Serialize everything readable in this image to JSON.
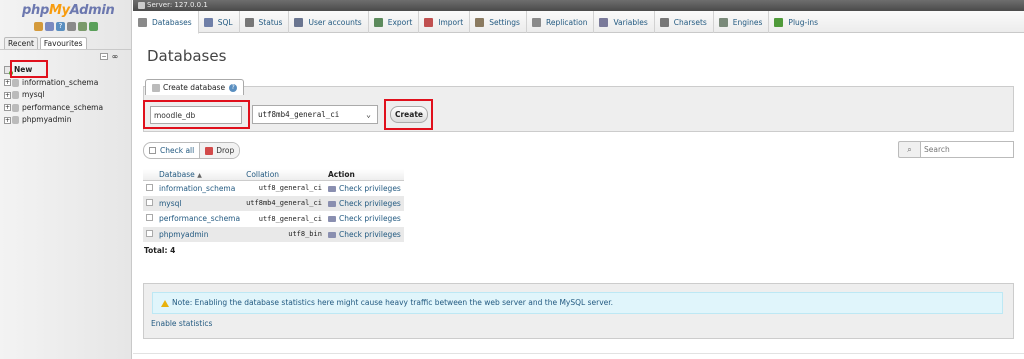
{
  "logo": {
    "php": "php",
    "my": "My",
    "admin": "Admin"
  },
  "nav": {
    "tabs": [
      "Recent",
      "Favourites"
    ],
    "new_label": "New",
    "databases": [
      "information_schema",
      "mysql",
      "performance_schema",
      "phpmyadmin"
    ]
  },
  "server_bar": {
    "label": "Server: 127.0.0.1"
  },
  "tabs": [
    {
      "label": "Databases",
      "icon": "database-icon",
      "color": "#8a8a8a"
    },
    {
      "label": "SQL",
      "icon": "sql-icon",
      "color": "#6f7fa8"
    },
    {
      "label": "Status",
      "icon": "status-icon",
      "color": "#777777"
    },
    {
      "label": "User accounts",
      "icon": "users-icon",
      "color": "#6a7590"
    },
    {
      "label": "Export",
      "icon": "export-icon",
      "color": "#5c8a5c"
    },
    {
      "label": "Import",
      "icon": "import-icon",
      "color": "#c05050"
    },
    {
      "label": "Settings",
      "icon": "settings-icon",
      "color": "#8a7a60"
    },
    {
      "label": "Replication",
      "icon": "replication-icon",
      "color": "#8a8a8a"
    },
    {
      "label": "Variables",
      "icon": "variables-icon",
      "color": "#7a7a9a"
    },
    {
      "label": "Charsets",
      "icon": "charsets-icon",
      "color": "#777777"
    },
    {
      "label": "Engines",
      "icon": "engines-icon",
      "color": "#7a8a7a"
    },
    {
      "label": "Plug-ins",
      "icon": "plugins-icon",
      "color": "#4f9a3a"
    }
  ],
  "main": {
    "title": "Databases",
    "create_tab_label": "Create database",
    "db_name_value": "moodle_db",
    "collation_value": "utf8mb4_general_ci",
    "create_button": "Create",
    "check_all": "Check all",
    "drop": "Drop",
    "search_placeholder": "Search",
    "table": {
      "headers": {
        "database": "Database",
        "collation": "Collation",
        "action": "Action"
      },
      "rows": [
        {
          "name": "information_schema",
          "collation": "utf8_general_ci",
          "action": "Check privileges"
        },
        {
          "name": "mysql",
          "collation": "utf8mb4_general_ci",
          "action": "Check privileges"
        },
        {
          "name": "performance_schema",
          "collation": "utf8_general_ci",
          "action": "Check privileges"
        },
        {
          "name": "phpmyadmin",
          "collation": "utf8_bin",
          "action": "Check privileges"
        }
      ]
    },
    "total": "Total: 4",
    "stats_notice": "Note: Enabling the database statistics here might cause heavy traffic between the web server and the MySQL server.",
    "enable_stats": "Enable statistics"
  },
  "colors": {
    "link": "#235a81",
    "highlight": "#e0101c",
    "notice_bg": "#e0f5fb"
  }
}
